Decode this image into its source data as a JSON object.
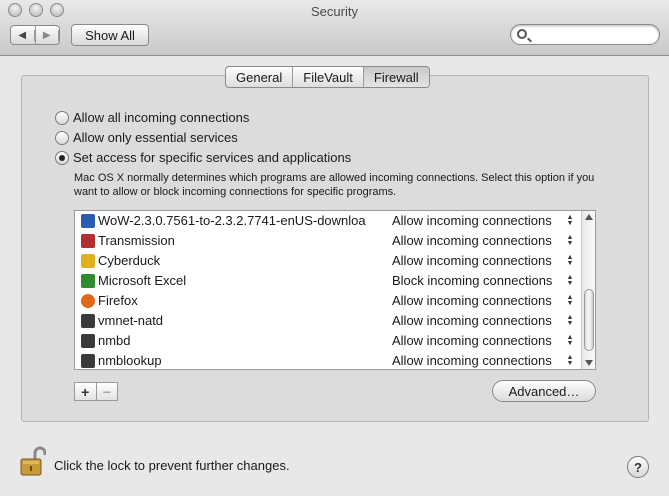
{
  "window": {
    "title": "Security"
  },
  "toolbar": {
    "back_icon": "triangle-left-icon",
    "forward_icon": "triangle-right-icon",
    "show_all_label": "Show All",
    "search_placeholder": "",
    "search_value": ""
  },
  "tabs": [
    {
      "label": "General",
      "active": false
    },
    {
      "label": "FileVault",
      "active": false
    },
    {
      "label": "Firewall",
      "active": true
    }
  ],
  "firewall": {
    "options": [
      {
        "label": "Allow all incoming connections",
        "selected": false
      },
      {
        "label": "Allow only essential services",
        "selected": false
      },
      {
        "label": "Set access for specific services and applications",
        "selected": true
      }
    ],
    "description": "Mac OS X normally determines which programs are allowed incoming connections. Select this option if you want to allow or block incoming connections for specific programs.",
    "apps": [
      {
        "name": "WoW-2.3.0.7561-to-2.3.2.7741-enUS-downloa",
        "rule": "Allow incoming connections",
        "icon": "wow-downloader-icon",
        "color": "#2a5db0"
      },
      {
        "name": "Transmission",
        "rule": "Allow incoming connections",
        "icon": "transmission-icon",
        "color": "#b03030"
      },
      {
        "name": "Cyberduck",
        "rule": "Allow incoming connections",
        "icon": "cyberduck-icon",
        "color": "#e0b020"
      },
      {
        "name": "Microsoft Excel",
        "rule": "Block incoming connections",
        "icon": "excel-icon",
        "color": "#2e8b2e"
      },
      {
        "name": "Firefox",
        "rule": "Allow incoming connections",
        "icon": "firefox-icon",
        "color": "#e06a1a"
      },
      {
        "name": "vmnet-natd",
        "rule": "Allow incoming connections",
        "icon": "terminal-exec-icon",
        "color": "#3a3a3a"
      },
      {
        "name": "nmbd",
        "rule": "Allow incoming connections",
        "icon": "terminal-exec-icon",
        "color": "#3a3a3a"
      },
      {
        "name": "nmblookup",
        "rule": "Allow incoming connections",
        "icon": "terminal-exec-icon",
        "color": "#3a3a3a"
      }
    ],
    "add_label": "+",
    "remove_label": "−",
    "advanced_label": "Advanced…"
  },
  "footer": {
    "lock_label": "Click the lock to prevent further changes.",
    "lock_icon": "unlocked-padlock-icon",
    "help_label": "?"
  }
}
